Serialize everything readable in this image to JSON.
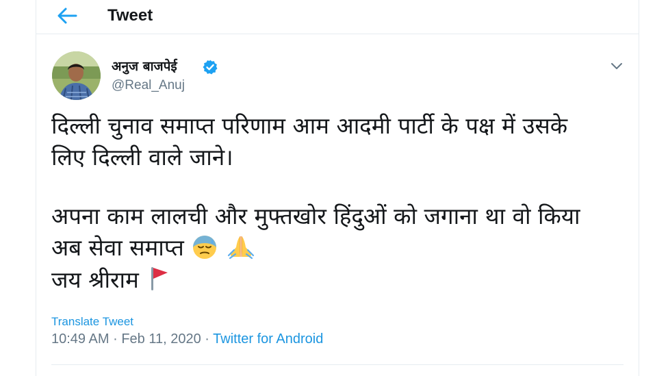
{
  "header": {
    "title": "Tweet",
    "back_icon": "arrow-left-icon"
  },
  "author": {
    "display_name": "अनुज बाजपेई",
    "handle": "@Real_Anuj",
    "verified": true
  },
  "tweet": {
    "lines": [
      "दिल्ली चुनाव समाप्त परिणाम आम आदमी पार्टी के पक्ष में उसके",
      "लिए दिल्ली वाले जाने।",
      "अपना काम लालची और मुफ्तखोर हिंदुओं को जगाना था वो किया",
      "अब सेवा समाप्त",
      "जय श्रीराम"
    ],
    "emojis": [
      "downcast-face-with-sweat-icon",
      "folded-hands-icon",
      "triangular-flag-icon"
    ]
  },
  "translate_label": "Translate Tweet",
  "meta": {
    "time": "10:49 AM",
    "separator": "·",
    "date": "Feb 11, 2020",
    "source": "Twitter for Android"
  },
  "colors": {
    "accent": "#1b95e0",
    "secondary_text": "#657786",
    "border": "#e6ecf0"
  }
}
